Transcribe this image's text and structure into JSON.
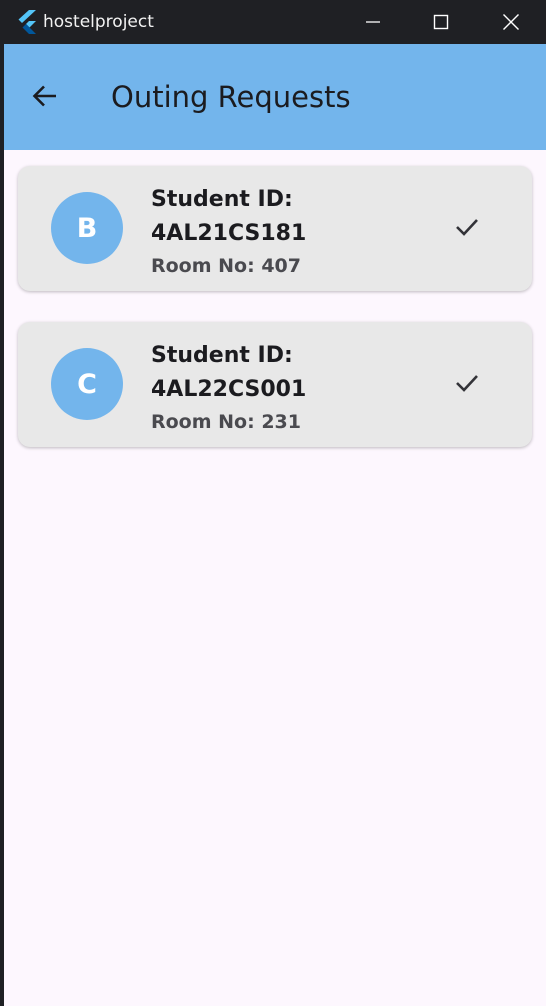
{
  "window": {
    "app_title": "hostelproject"
  },
  "appbar": {
    "title": "Outing Requests"
  },
  "colors": {
    "accent": "#73b5ec",
    "card_bg": "#e8e8e8",
    "page_bg": "#fdf7fe",
    "titlebar_bg": "#1f2024"
  },
  "requests": [
    {
      "initial": "B",
      "student_id_label": "Student ID:",
      "student_id": "4AL21CS181",
      "room": "Room No: 407",
      "action_icon": "check-icon"
    },
    {
      "initial": "C",
      "student_id_label": "Student ID:",
      "student_id": "4AL22CS001",
      "room": "Room No: 231",
      "action_icon": "check-icon"
    }
  ]
}
